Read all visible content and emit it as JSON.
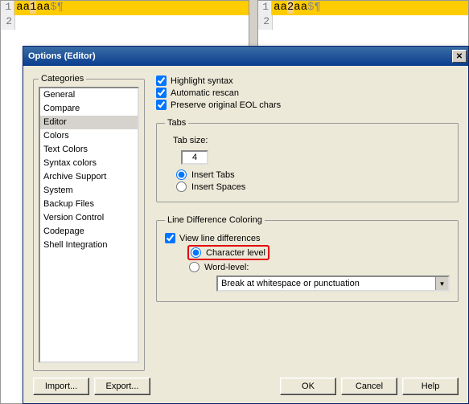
{
  "background": {
    "left_pane": {
      "line1_parts": [
        "aa",
        "1",
        "aa",
        "$¶"
      ],
      "line2_num": "2"
    },
    "right_pane": {
      "line1_parts": [
        "aa",
        "2",
        "aa",
        "$¶"
      ],
      "line2_num": "2"
    }
  },
  "dialog": {
    "title": "Options (Editor)",
    "close_glyph": "✕",
    "categories": {
      "legend": "Categories",
      "items": [
        "General",
        "Compare",
        "Editor",
        "Colors",
        "Text Colors",
        "Syntax colors",
        "Archive Support",
        "System",
        "Backup Files",
        "Version Control",
        "Codepage",
        "Shell Integration"
      ],
      "selected": "Editor"
    },
    "checks": {
      "highlight_syntax": {
        "label": "Highlight syntax",
        "checked": true
      },
      "automatic_rescan": {
        "label": "Automatic rescan",
        "checked": true
      },
      "preserve_eol": {
        "label": "Preserve original EOL chars",
        "checked": true
      }
    },
    "tabs": {
      "legend": "Tabs",
      "size_label": "Tab size:",
      "size_value": "4",
      "insert_tabs": "Insert Tabs",
      "insert_spaces": "Insert Spaces",
      "tabs_mode": "tabs"
    },
    "ldc": {
      "legend": "Line Difference Coloring",
      "view_line_diff": {
        "label": "View line differences",
        "checked": true
      },
      "char_level": "Character level",
      "word_level": "Word-level:",
      "mode": "char",
      "combo_value": "Break at whitespace or punctuation",
      "combo_arrow": "▼"
    },
    "buttons": {
      "import": "Import...",
      "export": "Export...",
      "ok": "OK",
      "cancel": "Cancel",
      "help": "Help"
    }
  }
}
